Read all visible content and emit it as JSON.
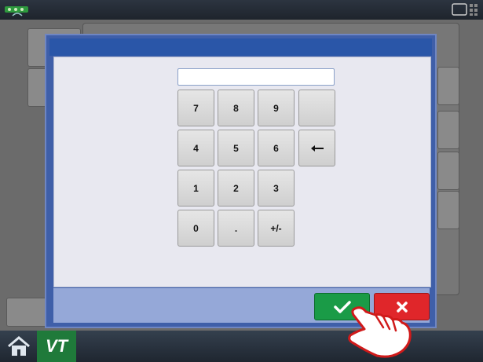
{
  "keypad": {
    "input_value": "",
    "rows": [
      [
        "7",
        "8",
        "9",
        ""
      ],
      [
        "4",
        "5",
        "6",
        "backspace"
      ],
      [
        "1",
        "2",
        "3"
      ],
      [
        "0",
        ".",
        "+/-"
      ]
    ],
    "k7": "7",
    "k8": "8",
    "k9": "9",
    "k4": "4",
    "k5": "5",
    "k6": "6",
    "k1": "1",
    "k2": "2",
    "k3": "3",
    "k0": "0",
    "kdot": ".",
    "ksign": "+/-"
  },
  "icons": {
    "backspace": "left-arrow-icon",
    "ok": "checkmark-icon",
    "cancel": "x-icon",
    "home": "home-icon",
    "pointer": "hand-pointer-icon"
  },
  "bottom_nav": {
    "vt_label": "VT"
  },
  "colors": {
    "ok_green": "#1a9b47",
    "cancel_red": "#e0262a",
    "dialog_blue": "#3f5fa9",
    "vt_green": "#1f7a3a"
  }
}
